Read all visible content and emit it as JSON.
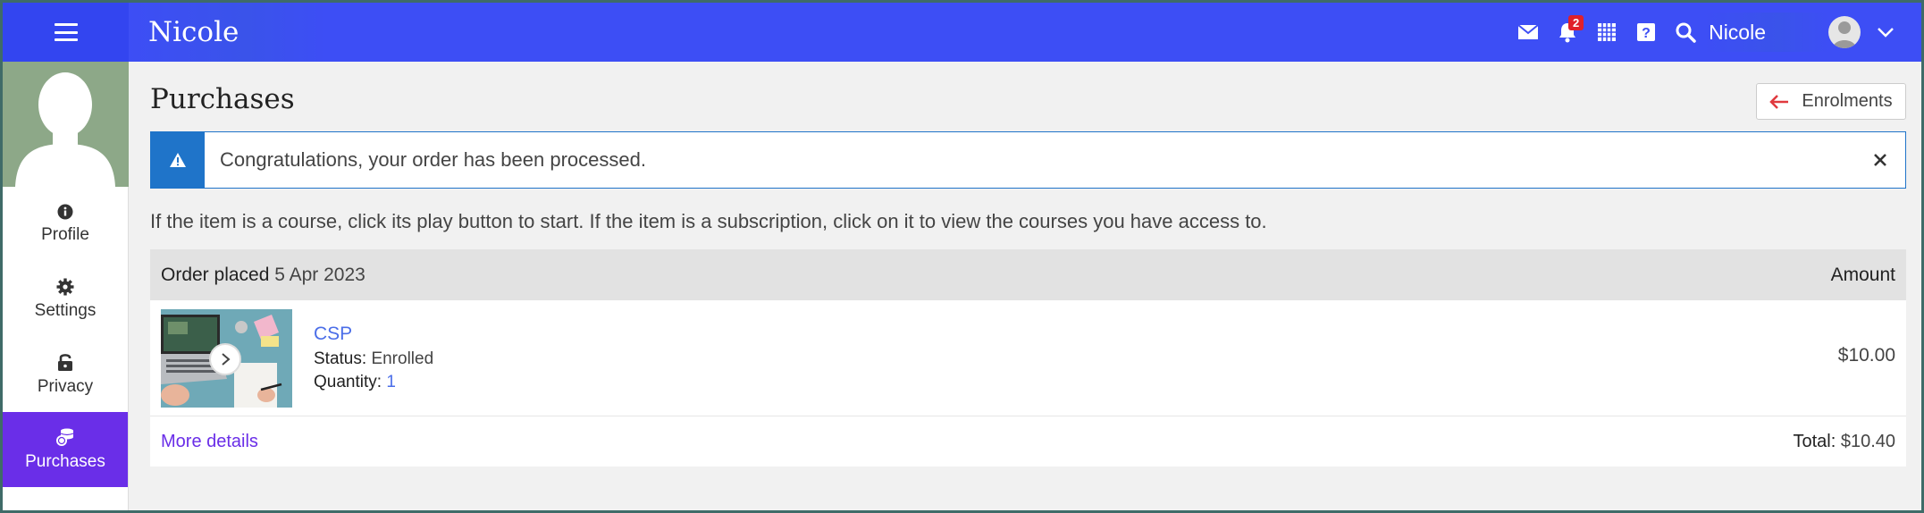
{
  "topbar": {
    "brand": "Nicole",
    "notification_count": "2",
    "user_name": "Nicole",
    "icons": [
      "menu-icon",
      "mail-icon",
      "bell-icon",
      "calendar-grid-icon",
      "help-icon",
      "search-icon",
      "avatar",
      "chevron-down-icon"
    ]
  },
  "sidebar": {
    "items": [
      {
        "label": "Profile",
        "icon": "info-icon"
      },
      {
        "label": "Settings",
        "icon": "gear-icon"
      },
      {
        "label": "Privacy",
        "icon": "lock-icon"
      },
      {
        "label": "Purchases",
        "icon": "coins-icon",
        "active": true
      }
    ]
  },
  "main": {
    "title": "Purchases",
    "back_button": "Enrolments",
    "alert": "Congratulations, your order has been processed.",
    "instructions": "If the item is a course, click its play button to start. If the item is a subscription, click on it to view the courses you have access to.",
    "order": {
      "placed_label": "Order placed",
      "placed_date": "5 Apr 2023",
      "amount_header": "Amount",
      "item": {
        "name": "CSP",
        "status_label": "Status:",
        "status_value": "Enrolled",
        "quantity_label": "Quantity:",
        "quantity_value": "1",
        "price": "$10.00"
      },
      "more_details": "More details",
      "total_label": "Total:",
      "total_value": "$10.40"
    }
  },
  "colors": {
    "topbar": "#3d4ef5",
    "active_sidebar": "#6a2ee8",
    "alert_accent": "#1f74c9",
    "link": "#4b6ee8",
    "badge": "#e0202a"
  }
}
